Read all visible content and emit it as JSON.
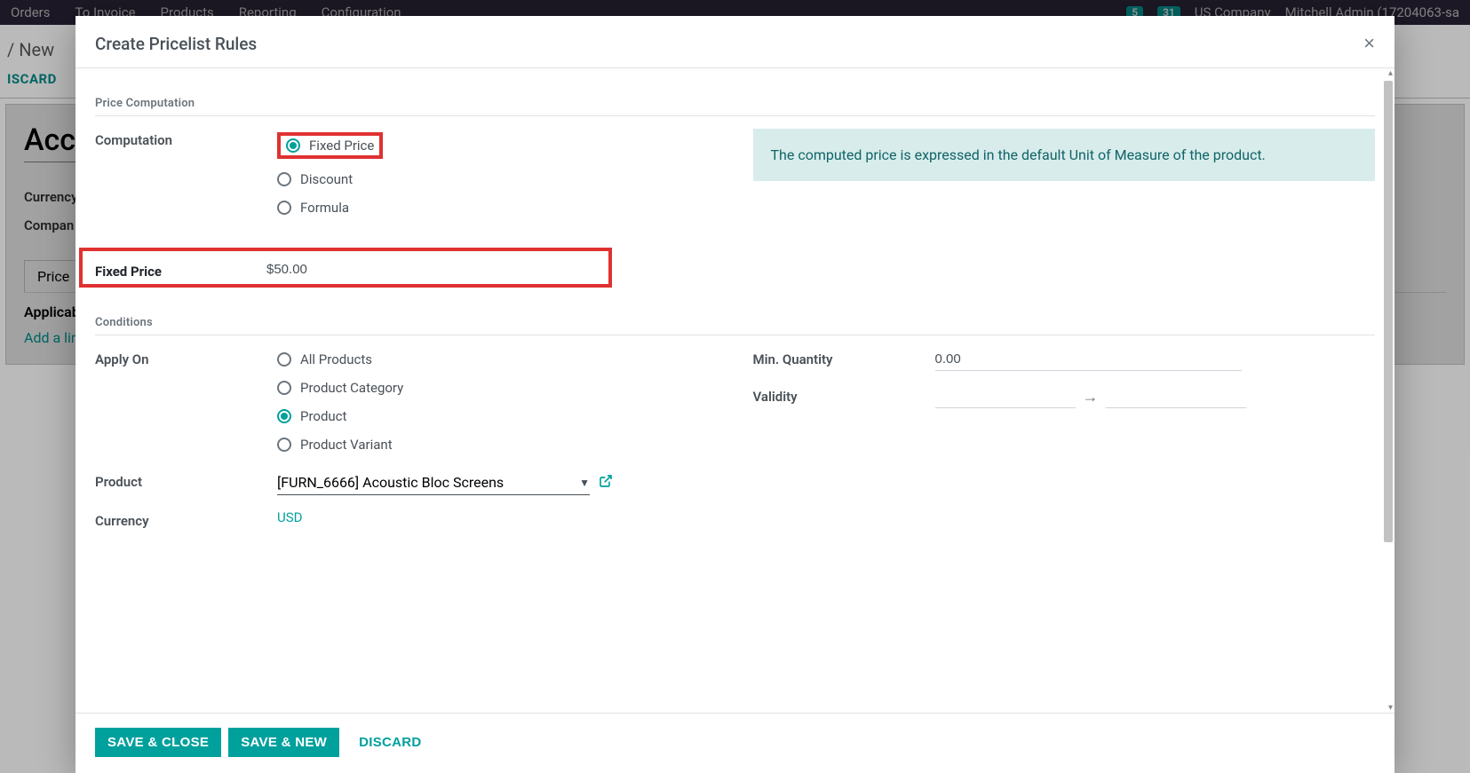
{
  "background": {
    "nav": {
      "orders": "Orders",
      "to_invoice": "To Invoice",
      "products": "Products",
      "reporting": "Reporting",
      "configuration": "Configuration"
    },
    "topbar_right": {
      "badge1": "5",
      "badge2": "31",
      "company": "US Company",
      "user": "Mitchell Admin (17204063-sa"
    },
    "breadcrumb": "/ New",
    "discard_label": "ISCARD",
    "form_title_partial": "Acc",
    "currency_label": "Currency",
    "company_label": "Compan",
    "tab_label": "Price",
    "table_header": "Applicab",
    "add_line": "Add a lin"
  },
  "modal": {
    "title": "Create Pricelist Rules",
    "close_symbol": "×",
    "sections": {
      "price_computation": "Price Computation",
      "conditions": "Conditions"
    },
    "computation": {
      "label": "Computation",
      "options": {
        "fixed": "Fixed Price",
        "discount": "Discount",
        "formula": "Formula"
      },
      "selected": "fixed"
    },
    "info_box": "The computed price is expressed in the default Unit of Measure of the product.",
    "fixed_price": {
      "label": "Fixed Price",
      "value": "$50.00"
    },
    "apply_on": {
      "label": "Apply On",
      "options": {
        "all": "All Products",
        "category": "Product Category",
        "product": "Product",
        "variant": "Product Variant"
      },
      "selected": "product"
    },
    "min_quantity": {
      "label": "Min. Quantity",
      "value": "0.00"
    },
    "validity": {
      "label": "Validity",
      "from": "",
      "to": "",
      "arrow": "→"
    },
    "product": {
      "label": "Product",
      "value": "[FURN_6666] Acoustic Bloc Screens"
    },
    "currency": {
      "label": "Currency",
      "value": "USD"
    },
    "footer": {
      "save_close": "SAVE & CLOSE",
      "save_new": "SAVE & NEW",
      "discard": "DISCARD"
    }
  }
}
